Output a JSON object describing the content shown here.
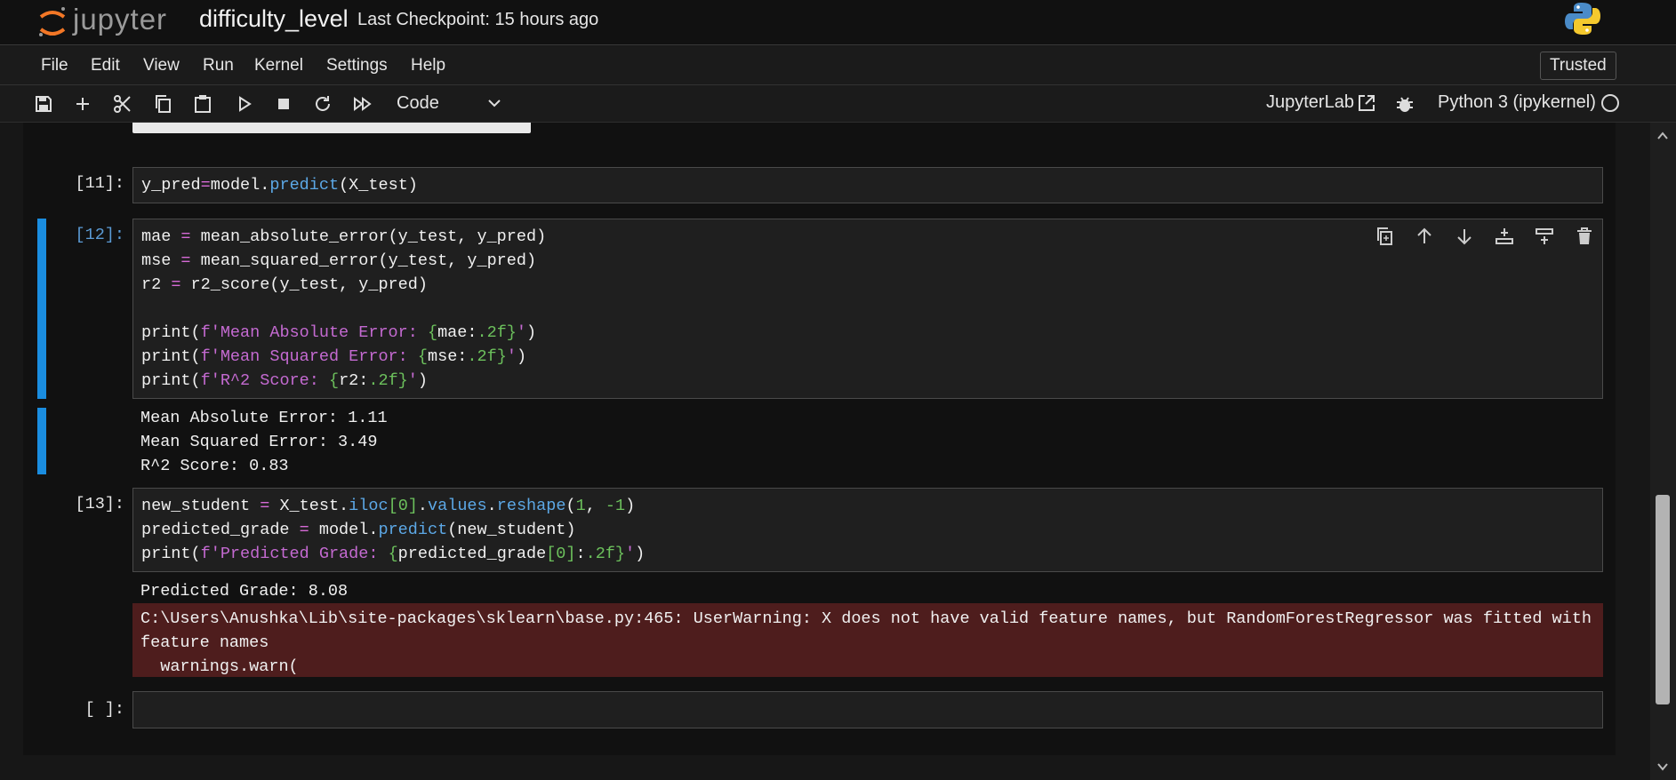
{
  "header": {
    "logo_text": "jupyter",
    "notebook_title": "difficulty_level",
    "checkpoint": "Last Checkpoint: 15 hours ago",
    "python_logo": "python-logo-icon"
  },
  "menu": {
    "items": [
      "File",
      "Edit",
      "View",
      "Run",
      "Kernel",
      "Settings",
      "Help"
    ],
    "trusted": "Trusted"
  },
  "toolbar": {
    "icons": [
      "save-icon",
      "add-cell-icon",
      "cut-icon",
      "copy-icon",
      "paste-icon",
      "run-icon",
      "stop-icon",
      "restart-icon",
      "run-all-icon"
    ],
    "cell_type": "Code",
    "jupyterlab_link": "JupyterLab",
    "kernel_name": "Python 3 (ipykernel)"
  },
  "cells": {
    "cell11": {
      "prompt": "[11]:",
      "code": "y_pred=model.predict(X_test)"
    },
    "cell12": {
      "prompt": "[12]:",
      "line1": "mae = mean_absolute_error(y_test, y_pred)",
      "line2": "mse = mean_squared_error(y_test, y_pred)",
      "line3": "r2 = r2_score(y_test, y_pred)",
      "line4": "print(f'Mean Absolute Error: {mae:.2f}')",
      "line5": "print(f'Mean Squared Error: {mse:.2f}')",
      "line6": "print(f'R^2 Score: {r2:.2f}')",
      "output": [
        "Mean Absolute Error: 1.11",
        "Mean Squared Error: 3.49",
        "R^2 Score: 0.83"
      ]
    },
    "cell13": {
      "prompt": "[13]:",
      "line1": "new_student = X_test.iloc[0].values.reshape(1, -1)",
      "line2": "predicted_grade = model.predict(new_student)",
      "line3": "print(f'Predicted Grade: {predicted_grade[0]:.2f}')",
      "output": "Predicted Grade: 8.08",
      "warning": "C:\\Users\\Anushka\\Lib\\site-packages\\sklearn\\base.py:465: UserWarning: X does not have valid feature names, but RandomForestRegressor was fitted with feature names\n  warnings.warn("
    },
    "empty": {
      "prompt": "[ ]:"
    }
  },
  "cell_actions": [
    "duplicate-icon",
    "move-up-icon",
    "move-down-icon",
    "insert-below-icon",
    "insert-above-icon",
    "delete-icon"
  ]
}
